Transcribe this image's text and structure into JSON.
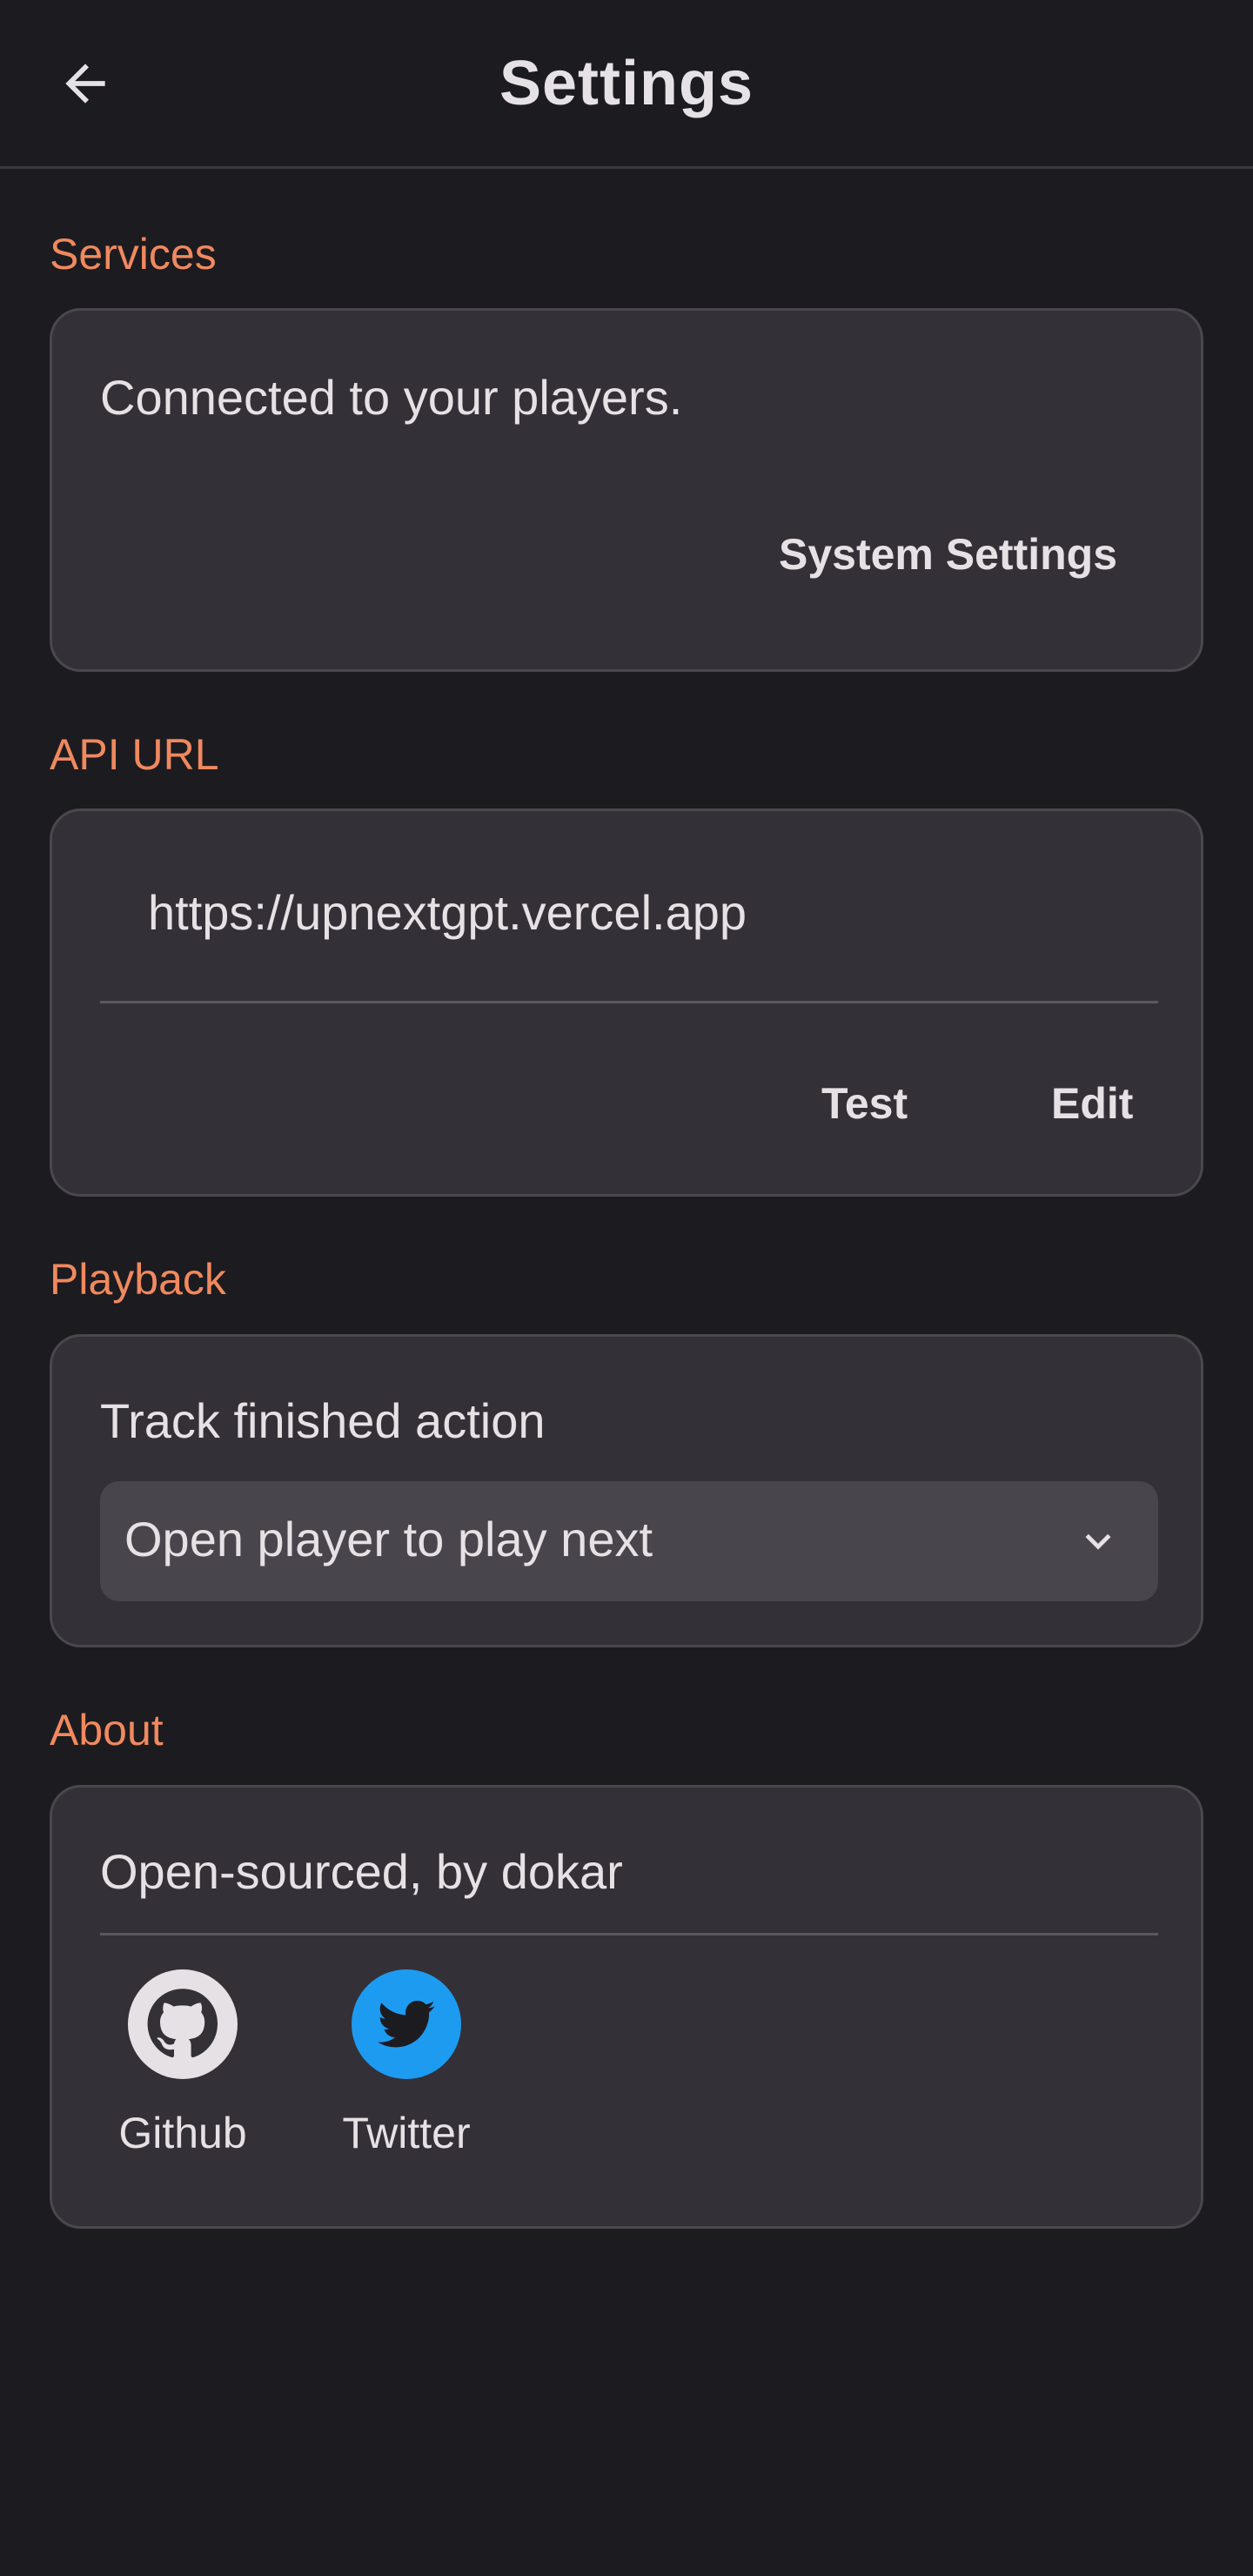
{
  "header": {
    "title": "Settings",
    "back_icon": "arrow-left-icon"
  },
  "colors": {
    "background": "#1c1b20",
    "card": "#333037",
    "section_title": "#f0895e",
    "twitter": "#1d9bf0",
    "github": "#e6e1e5"
  },
  "services": {
    "section_title": "Services",
    "status_text": "Connected to your players.",
    "system_settings_label": "System Settings"
  },
  "api": {
    "section_title": "API URL",
    "url_value": "https://upnextgpt.vercel.app",
    "test_label": "Test",
    "edit_label": "Edit"
  },
  "playback": {
    "section_title": "Playback",
    "field_label": "Track finished action",
    "selected_value": "Open player to play next",
    "chevron_icon": "chevron-down-icon"
  },
  "about": {
    "section_title": "About",
    "credit_text": "Open-sourced, by dokar",
    "links": [
      {
        "label": "Github",
        "icon": "github-icon"
      },
      {
        "label": "Twitter",
        "icon": "twitter-icon"
      }
    ]
  }
}
